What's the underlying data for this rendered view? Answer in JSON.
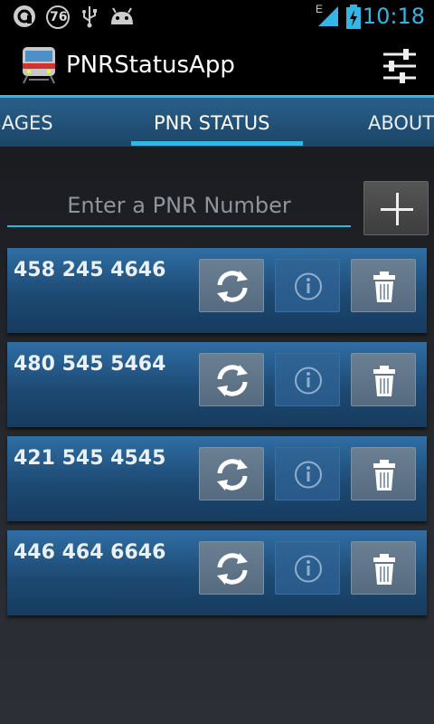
{
  "statusbar": {
    "badge_number": "76",
    "network": "E",
    "clock": "10:18",
    "icons": [
      "app-notify-icon",
      "badge-76-icon",
      "usb-icon",
      "android-icon",
      "signal-icon",
      "battery-charging-icon"
    ]
  },
  "actionbar": {
    "title": "PNRStatusApp",
    "app_icon": "train-icon",
    "settings_icon": "sliders-icon"
  },
  "tabs": [
    {
      "label": "SAGES"
    },
    {
      "label": "PNR STATUS",
      "selected": true
    },
    {
      "label": "ABOUT"
    }
  ],
  "input": {
    "placeholder": "Enter a PNR Number",
    "value": ""
  },
  "add_button_icon": "plus-icon",
  "pnr_list": [
    {
      "number": "458 245 4646"
    },
    {
      "number": "480 545 5464"
    },
    {
      "number": "421 545 4545"
    },
    {
      "number": "446 464 6646"
    }
  ],
  "colors": {
    "accent": "#33b5e5",
    "card": "#2f6ea4",
    "background": "#1a1c20"
  }
}
